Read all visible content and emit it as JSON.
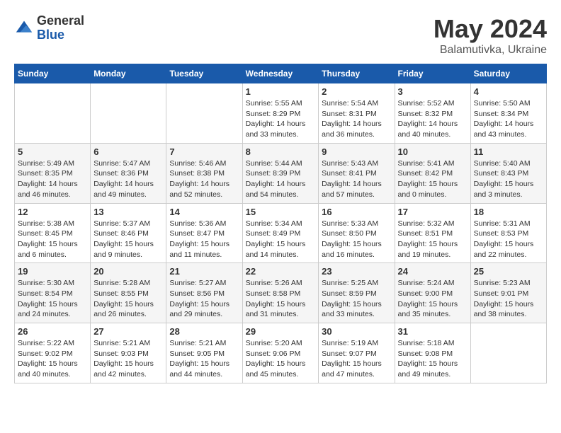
{
  "logo": {
    "general": "General",
    "blue": "Blue"
  },
  "title": "May 2024",
  "location": "Balamutivka, Ukraine",
  "days_of_week": [
    "Sunday",
    "Monday",
    "Tuesday",
    "Wednesday",
    "Thursday",
    "Friday",
    "Saturday"
  ],
  "weeks": [
    [
      {
        "day": "",
        "info": ""
      },
      {
        "day": "",
        "info": ""
      },
      {
        "day": "",
        "info": ""
      },
      {
        "day": "1",
        "info": "Sunrise: 5:55 AM\nSunset: 8:29 PM\nDaylight: 14 hours\nand 33 minutes."
      },
      {
        "day": "2",
        "info": "Sunrise: 5:54 AM\nSunset: 8:31 PM\nDaylight: 14 hours\nand 36 minutes."
      },
      {
        "day": "3",
        "info": "Sunrise: 5:52 AM\nSunset: 8:32 PM\nDaylight: 14 hours\nand 40 minutes."
      },
      {
        "day": "4",
        "info": "Sunrise: 5:50 AM\nSunset: 8:34 PM\nDaylight: 14 hours\nand 43 minutes."
      }
    ],
    [
      {
        "day": "5",
        "info": "Sunrise: 5:49 AM\nSunset: 8:35 PM\nDaylight: 14 hours\nand 46 minutes."
      },
      {
        "day": "6",
        "info": "Sunrise: 5:47 AM\nSunset: 8:36 PM\nDaylight: 14 hours\nand 49 minutes."
      },
      {
        "day": "7",
        "info": "Sunrise: 5:46 AM\nSunset: 8:38 PM\nDaylight: 14 hours\nand 52 minutes."
      },
      {
        "day": "8",
        "info": "Sunrise: 5:44 AM\nSunset: 8:39 PM\nDaylight: 14 hours\nand 54 minutes."
      },
      {
        "day": "9",
        "info": "Sunrise: 5:43 AM\nSunset: 8:41 PM\nDaylight: 14 hours\nand 57 minutes."
      },
      {
        "day": "10",
        "info": "Sunrise: 5:41 AM\nSunset: 8:42 PM\nDaylight: 15 hours\nand 0 minutes."
      },
      {
        "day": "11",
        "info": "Sunrise: 5:40 AM\nSunset: 8:43 PM\nDaylight: 15 hours\nand 3 minutes."
      }
    ],
    [
      {
        "day": "12",
        "info": "Sunrise: 5:38 AM\nSunset: 8:45 PM\nDaylight: 15 hours\nand 6 minutes."
      },
      {
        "day": "13",
        "info": "Sunrise: 5:37 AM\nSunset: 8:46 PM\nDaylight: 15 hours\nand 9 minutes."
      },
      {
        "day": "14",
        "info": "Sunrise: 5:36 AM\nSunset: 8:47 PM\nDaylight: 15 hours\nand 11 minutes."
      },
      {
        "day": "15",
        "info": "Sunrise: 5:34 AM\nSunset: 8:49 PM\nDaylight: 15 hours\nand 14 minutes."
      },
      {
        "day": "16",
        "info": "Sunrise: 5:33 AM\nSunset: 8:50 PM\nDaylight: 15 hours\nand 16 minutes."
      },
      {
        "day": "17",
        "info": "Sunrise: 5:32 AM\nSunset: 8:51 PM\nDaylight: 15 hours\nand 19 minutes."
      },
      {
        "day": "18",
        "info": "Sunrise: 5:31 AM\nSunset: 8:53 PM\nDaylight: 15 hours\nand 22 minutes."
      }
    ],
    [
      {
        "day": "19",
        "info": "Sunrise: 5:30 AM\nSunset: 8:54 PM\nDaylight: 15 hours\nand 24 minutes."
      },
      {
        "day": "20",
        "info": "Sunrise: 5:28 AM\nSunset: 8:55 PM\nDaylight: 15 hours\nand 26 minutes."
      },
      {
        "day": "21",
        "info": "Sunrise: 5:27 AM\nSunset: 8:56 PM\nDaylight: 15 hours\nand 29 minutes."
      },
      {
        "day": "22",
        "info": "Sunrise: 5:26 AM\nSunset: 8:58 PM\nDaylight: 15 hours\nand 31 minutes."
      },
      {
        "day": "23",
        "info": "Sunrise: 5:25 AM\nSunset: 8:59 PM\nDaylight: 15 hours\nand 33 minutes."
      },
      {
        "day": "24",
        "info": "Sunrise: 5:24 AM\nSunset: 9:00 PM\nDaylight: 15 hours\nand 35 minutes."
      },
      {
        "day": "25",
        "info": "Sunrise: 5:23 AM\nSunset: 9:01 PM\nDaylight: 15 hours\nand 38 minutes."
      }
    ],
    [
      {
        "day": "26",
        "info": "Sunrise: 5:22 AM\nSunset: 9:02 PM\nDaylight: 15 hours\nand 40 minutes."
      },
      {
        "day": "27",
        "info": "Sunrise: 5:21 AM\nSunset: 9:03 PM\nDaylight: 15 hours\nand 42 minutes."
      },
      {
        "day": "28",
        "info": "Sunrise: 5:21 AM\nSunset: 9:05 PM\nDaylight: 15 hours\nand 44 minutes."
      },
      {
        "day": "29",
        "info": "Sunrise: 5:20 AM\nSunset: 9:06 PM\nDaylight: 15 hours\nand 45 minutes."
      },
      {
        "day": "30",
        "info": "Sunrise: 5:19 AM\nSunset: 9:07 PM\nDaylight: 15 hours\nand 47 minutes."
      },
      {
        "day": "31",
        "info": "Sunrise: 5:18 AM\nSunset: 9:08 PM\nDaylight: 15 hours\nand 49 minutes."
      },
      {
        "day": "",
        "info": ""
      }
    ]
  ]
}
